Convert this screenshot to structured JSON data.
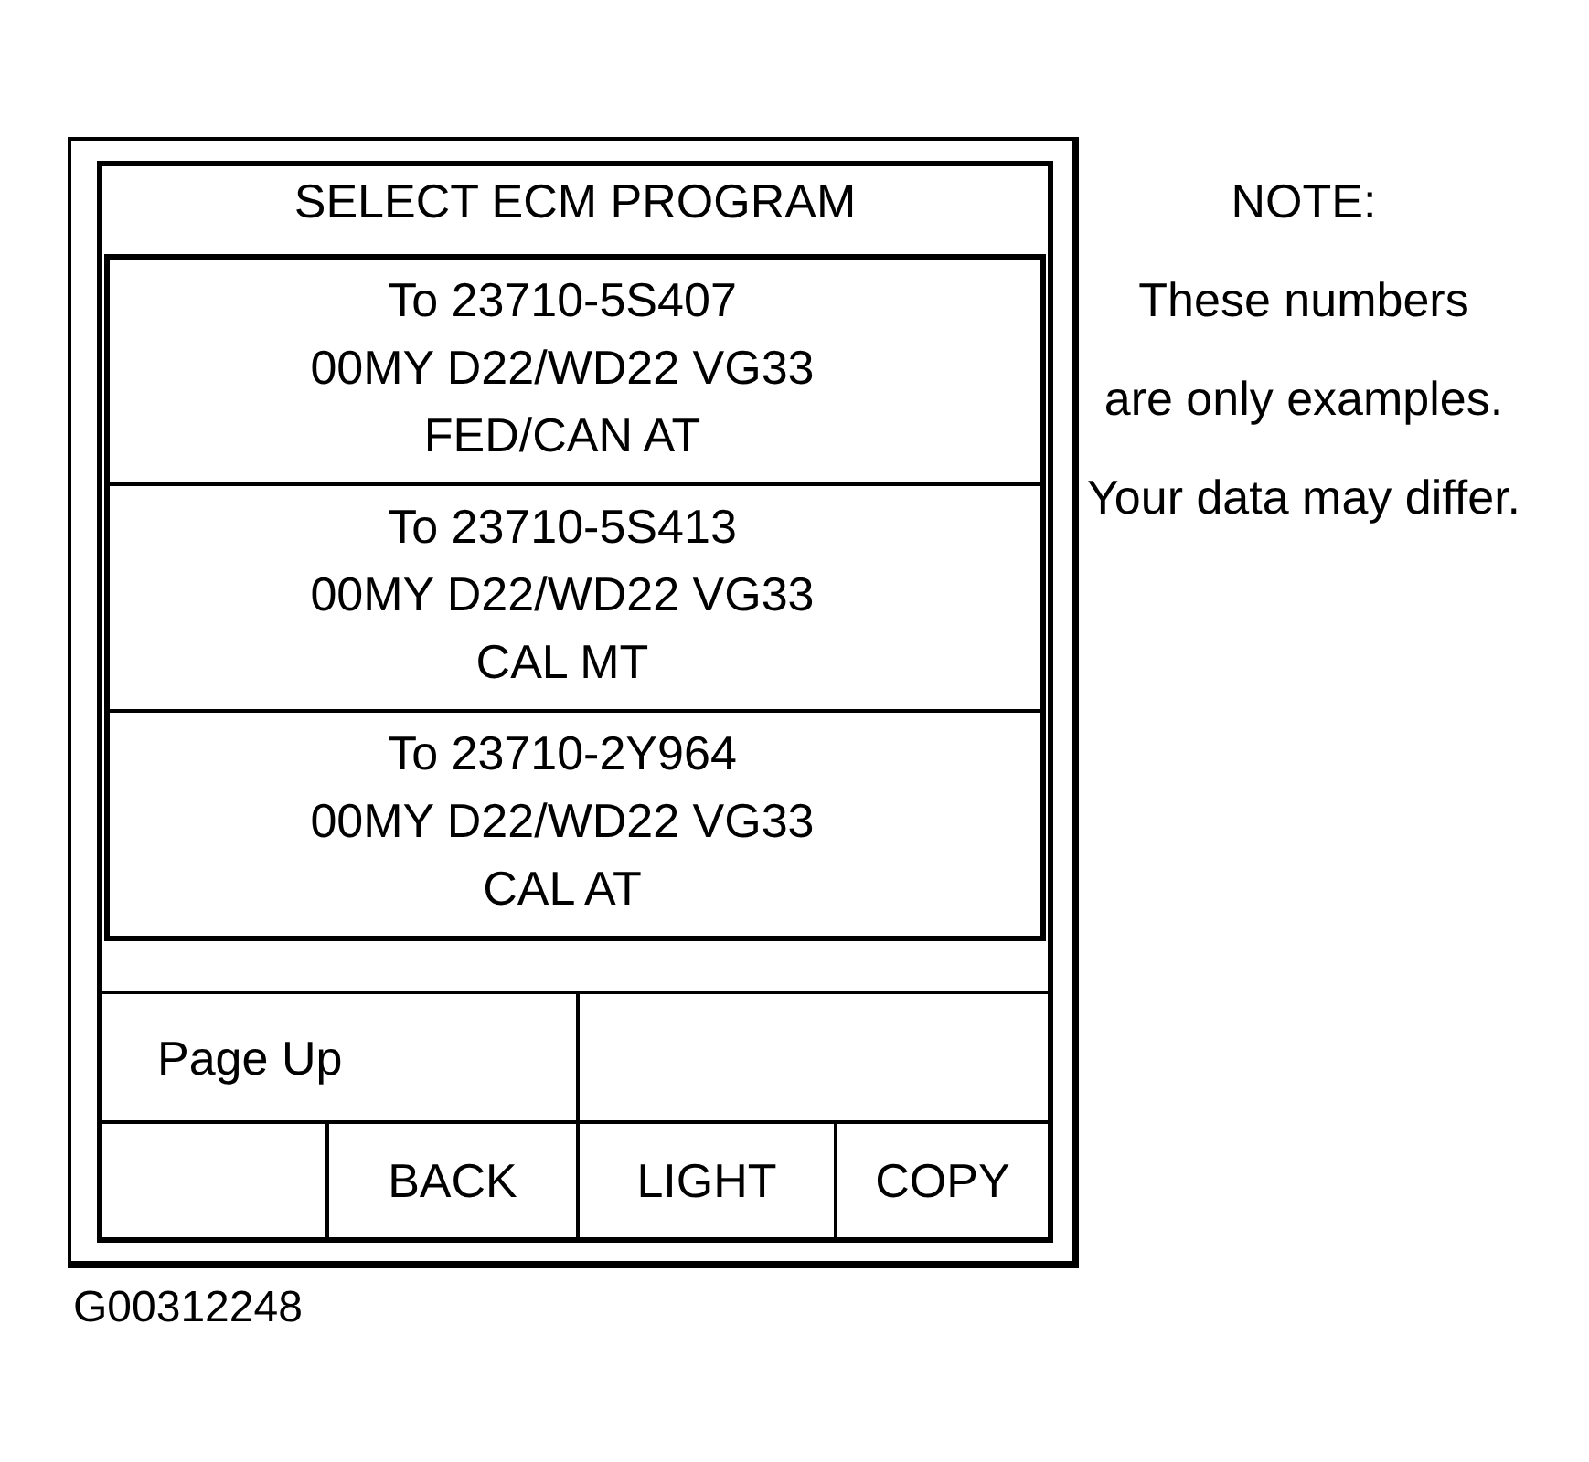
{
  "screen": {
    "title": "SELECT ECM PROGRAM",
    "programs": [
      {
        "lines": [
          "To 23710-5S407",
          "00MY D22/WD22 VG33",
          "FED/CAN AT"
        ]
      },
      {
        "lines": [
          "To 23710-5S413",
          "00MY D22/WD22 VG33",
          "CAL MT"
        ]
      },
      {
        "lines": [
          "To 23710-2Y964",
          "00MY D22/WD22 VG33",
          "CAL AT"
        ]
      }
    ],
    "soft_keys": [
      [
        {
          "kind": "label",
          "label": "Page Up"
        },
        {
          "kind": "blank"
        }
      ],
      [
        {
          "kind": "blank"
        },
        {
          "kind": "label",
          "label": "BACK"
        },
        {
          "kind": "label",
          "label": "LIGHT"
        },
        {
          "kind": "label",
          "label": "COPY"
        }
      ]
    ]
  },
  "note": {
    "heading": "NOTE:",
    "lines": [
      "These numbers",
      "are only examples.",
      "Your data may differ."
    ]
  },
  "figure_id": "G00312248"
}
